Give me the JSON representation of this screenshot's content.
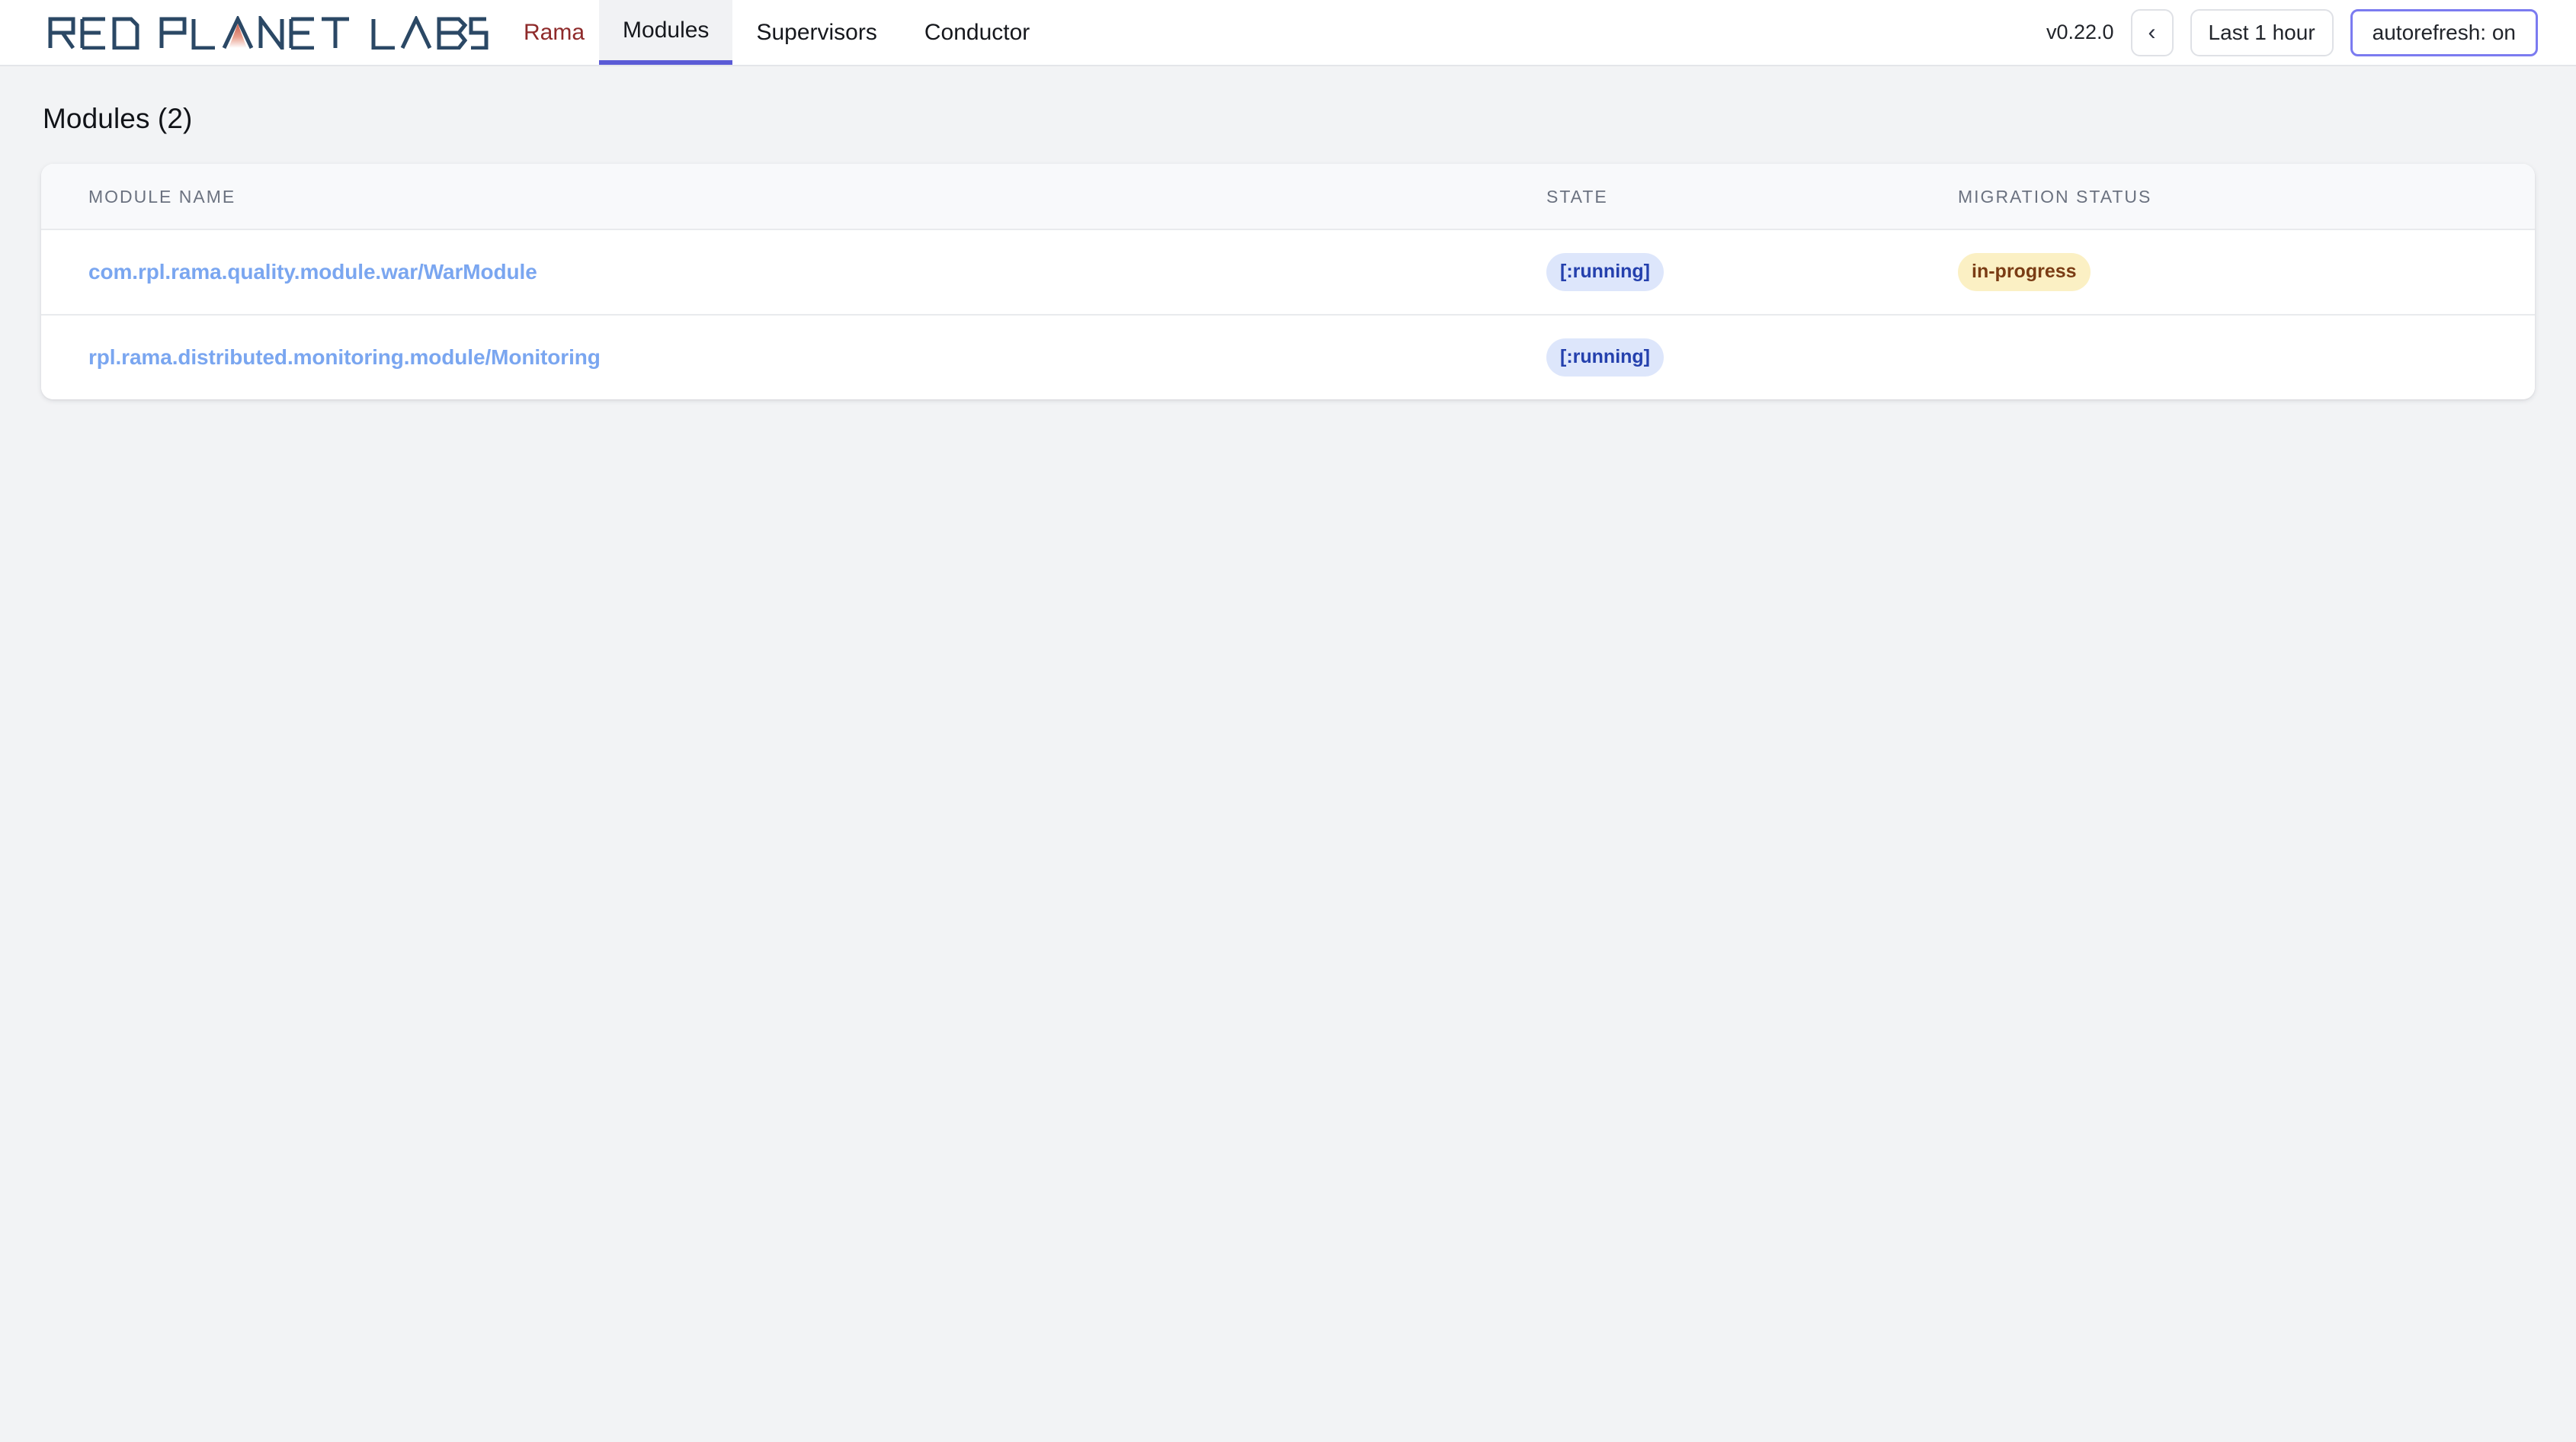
{
  "brand": {
    "name": "RED PLANET LABS",
    "logo_icon": "red-planet-labs-wordmark"
  },
  "nav": {
    "items": [
      {
        "label": "Rama",
        "active": false,
        "style": "brand"
      },
      {
        "label": "Modules",
        "active": true,
        "style": "normal"
      },
      {
        "label": "Supervisors",
        "active": false,
        "style": "normal"
      },
      {
        "label": "Conductor",
        "active": false,
        "style": "normal"
      }
    ]
  },
  "toolbar": {
    "version": "v0.22.0",
    "prev_icon": "chevron-left-icon",
    "prev_label": "‹",
    "time_range_label": "Last 1 hour",
    "autorefresh_label": "autorefresh: on"
  },
  "page": {
    "title": "Modules (2)"
  },
  "table": {
    "columns": [
      {
        "key": "module_name",
        "label": "MODULE NAME"
      },
      {
        "key": "state",
        "label": "STATE"
      },
      {
        "key": "migration_status",
        "label": "MIGRATION STATUS"
      }
    ],
    "rows": [
      {
        "module_name": "com.rpl.rama.quality.module.war/WarModule",
        "state": "[:running]",
        "migration_status": "in-progress"
      },
      {
        "module_name": "rpl.rama.distributed.monitoring.module/Monitoring",
        "state": "[:running]",
        "migration_status": ""
      }
    ]
  },
  "colors": {
    "page_background": "#f2f3f5",
    "header_background": "#ffffff",
    "active_tab_underline": "#5b5bd6",
    "brand_link": "#8e2a2a",
    "module_link": "#7aa6f0",
    "state_badge_bg": "#dde6fb",
    "state_badge_text": "#2440ad",
    "migration_badge_bg": "#fbf0c4",
    "migration_badge_text": "#7a3c14",
    "accent_button_border": "#7b7bf0",
    "logo_dark": "#2b4865",
    "logo_accent": "#e9a08e"
  }
}
